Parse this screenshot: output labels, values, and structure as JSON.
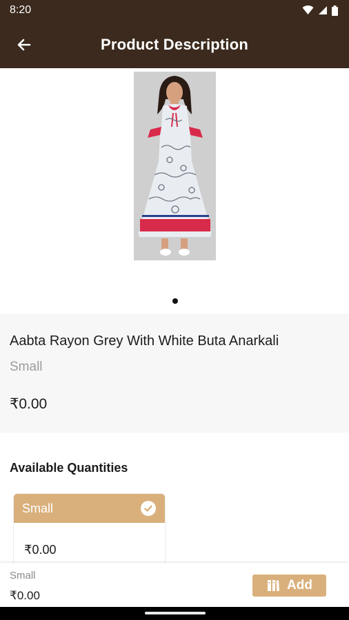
{
  "status_bar": {
    "time": "8:20"
  },
  "header": {
    "title": "Product Description",
    "back_icon": "arrow-left-icon"
  },
  "product": {
    "name": "Aabta Rayon Grey With White Buta Anarkali",
    "size": "Small",
    "price": "₹0.00",
    "image_count": 1
  },
  "quantities": {
    "heading": "Available Quantities",
    "items": [
      {
        "label": "Small",
        "price": "₹0.00",
        "selected": true
      }
    ]
  },
  "bottom_bar": {
    "size": "Small",
    "price": "₹0.00",
    "add_label": "Add",
    "add_icon": "book-icon"
  },
  "colors": {
    "app_bar": "#3b2a1d",
    "accent": "#d9b07b",
    "info_bg": "#f7f7f7",
    "muted_text": "#9c9c9c"
  }
}
